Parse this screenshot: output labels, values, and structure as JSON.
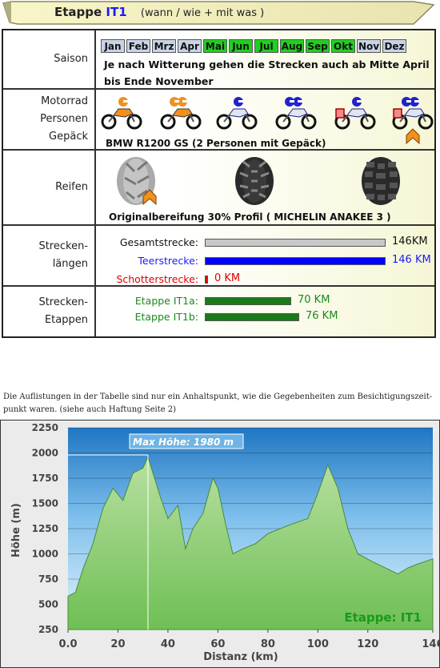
{
  "banner": {
    "prefix": "Etappe",
    "id": "IT1",
    "subtitle": "(wann / wie + mit was )"
  },
  "season": {
    "label": "Saison",
    "months": [
      {
        "name": "Jan",
        "active": false
      },
      {
        "name": "Feb",
        "active": false
      },
      {
        "name": "Mrz",
        "active": false
      },
      {
        "name": "Apr",
        "active": false
      },
      {
        "name": "Mai",
        "active": true
      },
      {
        "name": "Jun",
        "active": true
      },
      {
        "name": "Jul",
        "active": true
      },
      {
        "name": "Aug",
        "active": true
      },
      {
        "name": "Sep",
        "active": true
      },
      {
        "name": "Okt",
        "active": true
      },
      {
        "name": "Nov",
        "active": false
      },
      {
        "name": "Dez",
        "active": false
      }
    ],
    "text": "Je nach Witterung gehen die Strecken auch ab Mitte April bis Ende November"
  },
  "vehicle": {
    "label_lines": [
      "Motorrad",
      "Personen",
      "Gepäck"
    ],
    "text": "BMW R1200 GS  (2 Personen mit Gepäck)",
    "icons": [
      "motorcycle-1-person-icon",
      "motorcycle-2-persons-icon",
      "touring-motorcycle-1-person-icon",
      "touring-motorcycle-2-persons-icon",
      "touring-motorcycle-luggage-icon",
      "touring-motorcycle-2-persons-luggage-icon"
    ]
  },
  "tires": {
    "label": "Reifen",
    "text": "Originalbereifung  30% Profil ( MICHELIN ANAKEE 3 )"
  },
  "lengths": {
    "label_lines": [
      "Strecken-",
      "längen"
    ],
    "rows": [
      {
        "label": "Gesamtstrecke:",
        "value": "146KM",
        "km": 146,
        "color": "#111111",
        "bar": "#c8c8c8"
      },
      {
        "label": "Teerstrecke:",
        "value": "146 KM",
        "km": 146,
        "color": "#1a1aff",
        "bar": "#0000ff"
      },
      {
        "label": "Schotterstrecke:",
        "value": "0 KM",
        "km": 0,
        "color": "#e00000",
        "bar": "#d40000"
      }
    ]
  },
  "stages": {
    "label_lines": [
      "Strecken-",
      "Etappen"
    ],
    "rows": [
      {
        "label": "Etappe IT1a:",
        "value": "70 KM",
        "km": 70,
        "color": "#1a8a1a",
        "bar": "#1a7a1a"
      },
      {
        "label": "Etappe IT1b:",
        "value": "76 KM",
        "km": 76,
        "color": "#1a8a1a",
        "bar": "#1a7a1a"
      }
    ]
  },
  "disclaimer": "Die Auflistungen in der Tabelle sind nur ein Anhaltspunkt, wie die Gegebenheiten zum Besichtigungszeit-punkt waren. (siehe auch Haftung Seite 2)",
  "chart_data": {
    "type": "area",
    "xlabel": "Distanz  (km)",
    "ylabel": "Höhe  (m)",
    "annotation": "Max Höhe: 1980 m",
    "series_label": "Etappe: IT1",
    "xlim": [
      0,
      146
    ],
    "ylim": [
      250,
      2250
    ],
    "x_ticks": [
      "0.0",
      "20",
      "40",
      "60",
      "80",
      "100",
      "120",
      "146"
    ],
    "y_ticks": [
      "250",
      "500",
      "750",
      "1000",
      "1250",
      "1500",
      "1750",
      "2000",
      "2250"
    ],
    "max_point": {
      "x": 32,
      "y": 1980
    },
    "x": [
      0,
      3,
      6,
      10,
      14,
      18,
      22,
      26,
      30,
      32,
      34,
      37,
      40,
      44,
      47,
      50,
      54,
      58,
      60,
      63,
      66,
      70,
      75,
      80,
      88,
      96,
      100,
      104,
      108,
      112,
      116,
      122,
      128,
      132,
      136,
      140,
      146
    ],
    "y": [
      580,
      620,
      850,
      1100,
      1450,
      1650,
      1530,
      1800,
      1850,
      1960,
      1800,
      1560,
      1350,
      1480,
      1050,
      1250,
      1400,
      1750,
      1650,
      1300,
      1000,
      1050,
      1100,
      1200,
      1280,
      1350,
      1600,
      1880,
      1650,
      1250,
      1000,
      920,
      850,
      800,
      860,
      900,
      950
    ]
  }
}
